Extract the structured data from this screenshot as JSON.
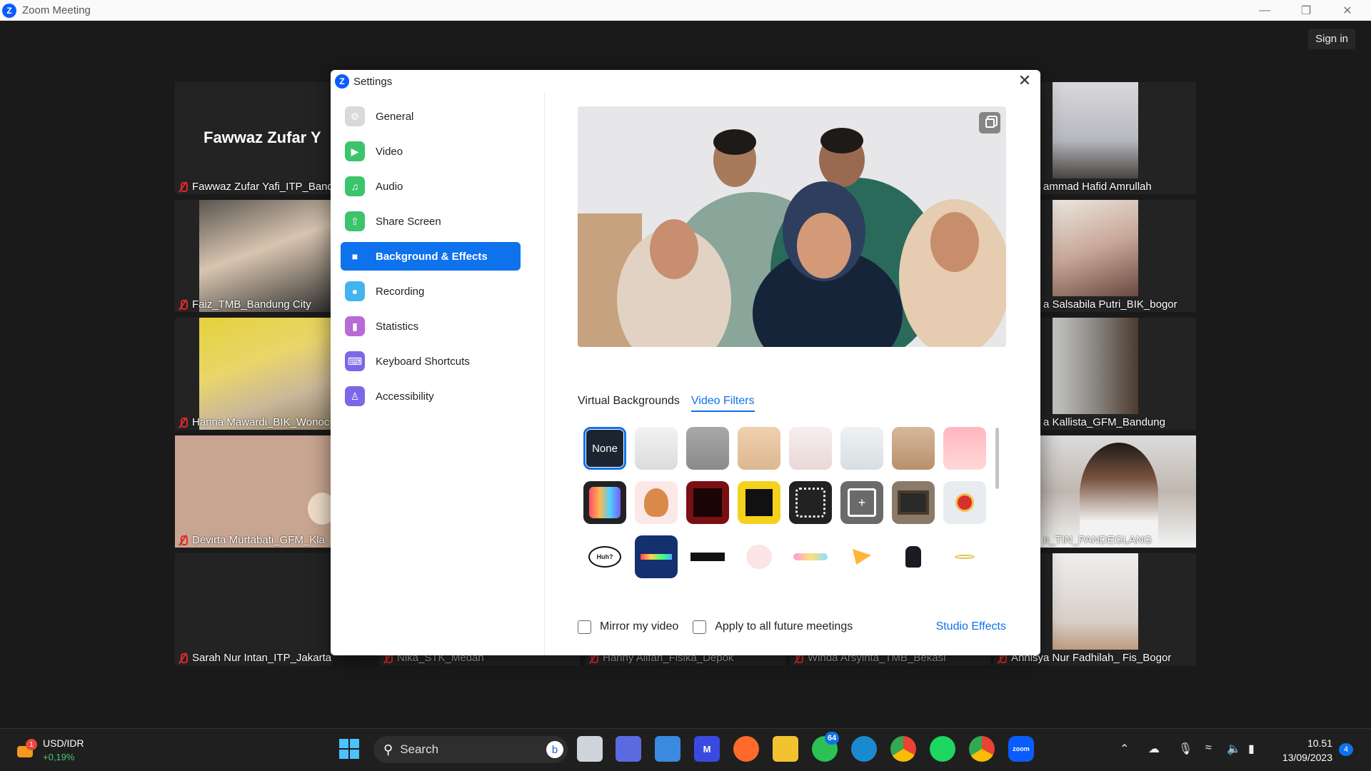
{
  "window": {
    "title": "Zoom Meeting",
    "sign_in": "Sign in"
  },
  "tiles": {
    "big_name": "Fawwaz Zufar Y",
    "left": [
      "Fawwaz Zufar Yafi_ITP_Band",
      "Faiz_TMB_Bandung City",
      "Hanna Mawardi_BIK_Wonoс",
      "Devirta Murtabati_GFM_Kla",
      "Sarah Nur Intan_ITP_Jakarta"
    ],
    "right": [
      "ammad Hafid Amrullah",
      "a Salsabila Putri_BIK_bogor",
      "a Kallista_GFM_Bandung",
      "n_TIN_PANDEGLANG",
      "Annisya Nur Fadhilah_ Fis_Bogor"
    ],
    "bottom": [
      "Nika_STK_Medan",
      "Hanny Alifah_Fisika_Depok",
      "Winda Arsyinta_TMB_Bekasi"
    ]
  },
  "settings": {
    "title": "Settings",
    "nav": [
      {
        "label": "General",
        "icon": "gear-icon",
        "color": "#d9d9d9"
      },
      {
        "label": "Video",
        "icon": "video-camera-icon",
        "color": "#3cc46b"
      },
      {
        "label": "Audio",
        "icon": "headphones-icon",
        "color": "#3cc46b"
      },
      {
        "label": "Share Screen",
        "icon": "share-screen-icon",
        "color": "#3cc46b"
      },
      {
        "label": "Background & Effects",
        "icon": "person-background-icon",
        "color": "#0e72ed"
      },
      {
        "label": "Recording",
        "icon": "record-icon",
        "color": "#42b4ee"
      },
      {
        "label": "Statistics",
        "icon": "statistics-icon",
        "color": "#b86ad6"
      },
      {
        "label": "Keyboard Shortcuts",
        "icon": "keyboard-icon",
        "color": "#7e66e8"
      },
      {
        "label": "Accessibility",
        "icon": "accessibility-icon",
        "color": "#7e66e8"
      }
    ],
    "active_nav": "Background & Effects",
    "tabs": [
      "Virtual Backgrounds",
      "Video Filters"
    ],
    "active_tab": "Video Filters",
    "filter_none_label": "None",
    "filter_speech_label": "Huh?",
    "mirror_label": "Mirror my video",
    "apply_label": "Apply to all future meetings",
    "studio_label": "Studio Effects"
  },
  "taskbar": {
    "ticker_symbol": "USD/IDR",
    "ticker_change": "+0,19%",
    "ticker_badge": "1",
    "search_label": "Search",
    "whatsapp_badge": "64",
    "time": "10.51",
    "date": "13/09/2023",
    "notif_count": "4"
  }
}
